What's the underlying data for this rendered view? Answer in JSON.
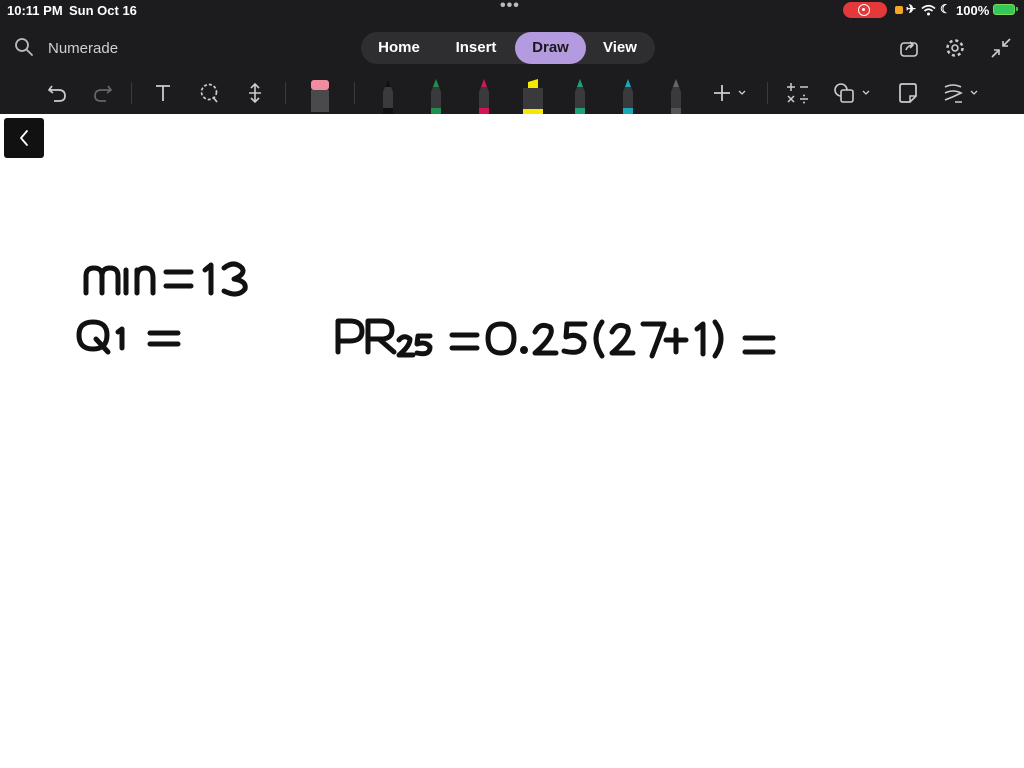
{
  "status_bar": {
    "time": "10:11 PM",
    "date": "Sun Oct 16",
    "battery": "100%",
    "accent_recording": "#e5383b",
    "battery_color": "#34c759"
  },
  "app": {
    "name": "Numerade",
    "tabs": [
      {
        "label": "Home",
        "active": false
      },
      {
        "label": "Insert",
        "active": false
      },
      {
        "label": "Draw",
        "active": true
      },
      {
        "label": "View",
        "active": false
      }
    ],
    "active_tab_color": "#b49be0"
  },
  "toolbar": {
    "tools": [
      "undo-icon",
      "redo-icon",
      "text-icon",
      "lasso-icon",
      "space-icon",
      "eraser-icon"
    ],
    "pens": [
      {
        "name": "pen-black",
        "color": "#2a2a2a"
      },
      {
        "name": "pen-green",
        "color": "#1f8f4e"
      },
      {
        "name": "pen-magenta",
        "color": "#d4145a"
      },
      {
        "name": "highlighter-yellow",
        "color": "#f7e600"
      },
      {
        "name": "pen-teal",
        "color": "#1f9f7a"
      },
      {
        "name": "pen-cyan",
        "color": "#1aa7b8"
      },
      {
        "name": "pen-gray",
        "color": "#555555"
      }
    ],
    "extras": [
      "add-pen-icon",
      "math-icon",
      "shapes-icon",
      "ink-to-shape-icon",
      "ink-to-text-icon"
    ]
  },
  "canvas": {
    "lines": [
      "min = 13",
      "Q1 =",
      "PR25 = 0.25(27+1) ="
    ],
    "ink_color": "#111111"
  }
}
